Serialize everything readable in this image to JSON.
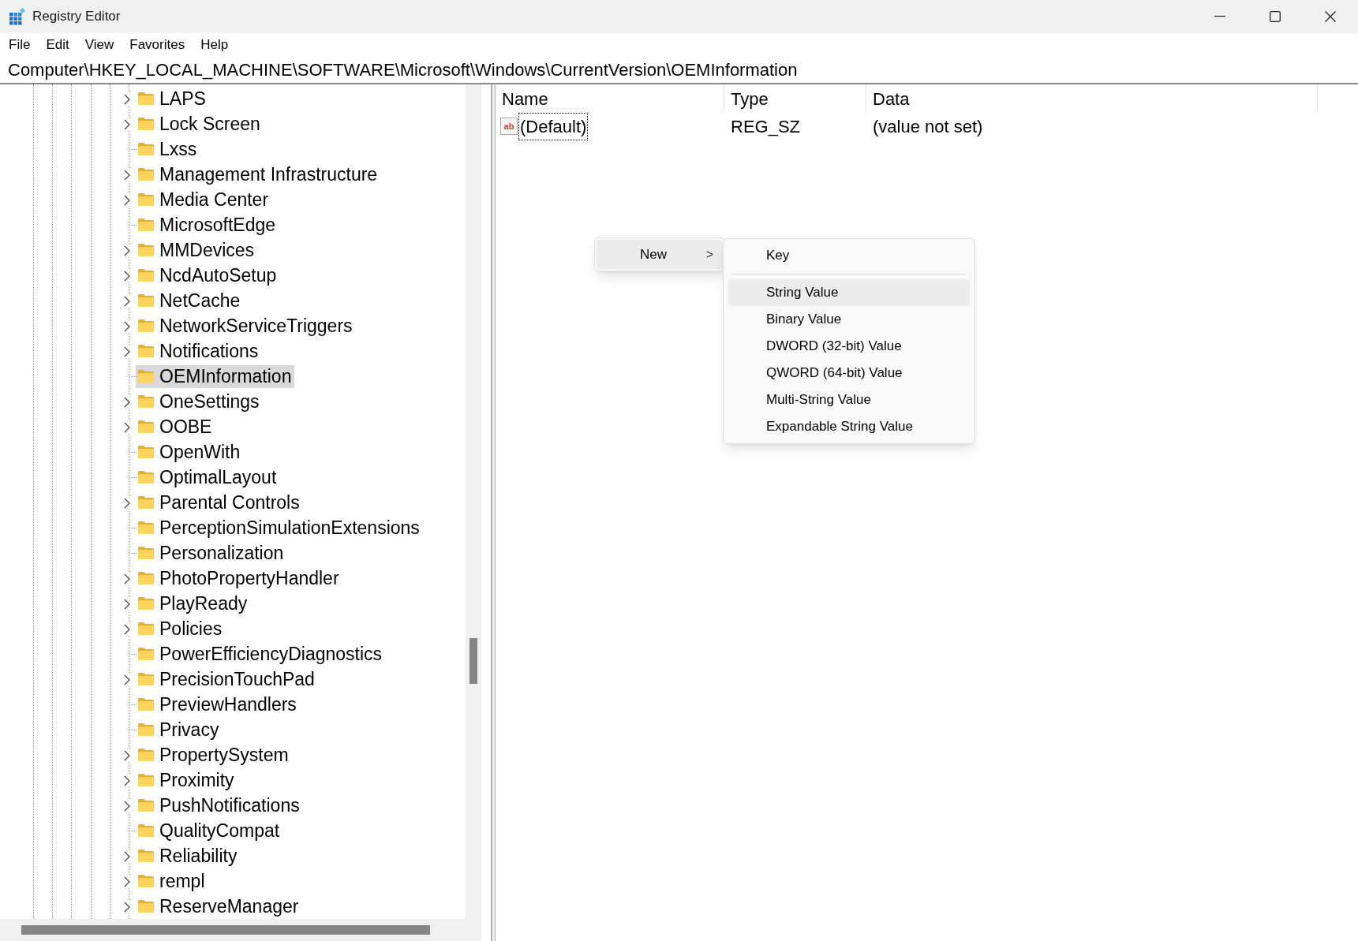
{
  "window": {
    "title": "Registry Editor"
  },
  "menu_bar": [
    "File",
    "Edit",
    "View",
    "Favorites",
    "Help"
  ],
  "address_bar": "Computer\\HKEY_LOCAL_MACHINE\\SOFTWARE\\Microsoft\\Windows\\CurrentVersion\\OEMInformation",
  "tree": [
    {
      "label": "LAPS",
      "expandable": true,
      "selected": false
    },
    {
      "label": "Lock Screen",
      "expandable": true,
      "selected": false
    },
    {
      "label": "Lxss",
      "expandable": false,
      "selected": false
    },
    {
      "label": "Management Infrastructure",
      "expandable": true,
      "selected": false
    },
    {
      "label": "Media Center",
      "expandable": true,
      "selected": false
    },
    {
      "label": "MicrosoftEdge",
      "expandable": false,
      "selected": false
    },
    {
      "label": "MMDevices",
      "expandable": true,
      "selected": false
    },
    {
      "label": "NcdAutoSetup",
      "expandable": true,
      "selected": false
    },
    {
      "label": "NetCache",
      "expandable": true,
      "selected": false
    },
    {
      "label": "NetworkServiceTriggers",
      "expandable": true,
      "selected": false
    },
    {
      "label": "Notifications",
      "expandable": true,
      "selected": false
    },
    {
      "label": "OEMInformation",
      "expandable": false,
      "selected": true
    },
    {
      "label": "OneSettings",
      "expandable": true,
      "selected": false
    },
    {
      "label": "OOBE",
      "expandable": true,
      "selected": false
    },
    {
      "label": "OpenWith",
      "expandable": false,
      "selected": false
    },
    {
      "label": "OptimalLayout",
      "expandable": false,
      "selected": false
    },
    {
      "label": "Parental Controls",
      "expandable": true,
      "selected": false
    },
    {
      "label": "PerceptionSimulationExtensions",
      "expandable": false,
      "selected": false
    },
    {
      "label": "Personalization",
      "expandable": false,
      "selected": false
    },
    {
      "label": "PhotoPropertyHandler",
      "expandable": true,
      "selected": false
    },
    {
      "label": "PlayReady",
      "expandable": true,
      "selected": false
    },
    {
      "label": "Policies",
      "expandable": true,
      "selected": false
    },
    {
      "label": "PowerEfficiencyDiagnostics",
      "expandable": false,
      "selected": false
    },
    {
      "label": "PrecisionTouchPad",
      "expandable": true,
      "selected": false
    },
    {
      "label": "PreviewHandlers",
      "expandable": false,
      "selected": false
    },
    {
      "label": "Privacy",
      "expandable": false,
      "selected": false
    },
    {
      "label": "PropertySystem",
      "expandable": true,
      "selected": false
    },
    {
      "label": "Proximity",
      "expandable": true,
      "selected": false
    },
    {
      "label": "PushNotifications",
      "expandable": true,
      "selected": false
    },
    {
      "label": "QualityCompat",
      "expandable": false,
      "selected": false
    },
    {
      "label": "Reliability",
      "expandable": true,
      "selected": false
    },
    {
      "label": "rempl",
      "expandable": true,
      "selected": false
    },
    {
      "label": "ReserveManager",
      "expandable": true,
      "selected": false
    }
  ],
  "values_table": {
    "columns": [
      "Name",
      "Type",
      "Data"
    ],
    "rows": [
      {
        "icon_text": "ab",
        "name": "(Default)",
        "type": "REG_SZ",
        "data": "(value not set)",
        "selected": true
      }
    ]
  },
  "context_menu": {
    "items": [
      {
        "label": "New",
        "expanded": true,
        "chevron": ">"
      }
    ],
    "submenu": [
      {
        "label": "Key",
        "selected": false,
        "separator_after": true
      },
      {
        "label": "String Value",
        "selected": true,
        "separator_after": false
      },
      {
        "label": "Binary Value",
        "selected": false,
        "separator_after": false
      },
      {
        "label": "DWORD (32-bit) Value",
        "selected": false,
        "separator_after": false
      },
      {
        "label": "QWORD (64-bit) Value",
        "selected": false,
        "separator_after": false
      },
      {
        "label": "Multi-String Value",
        "selected": false,
        "separator_after": false
      },
      {
        "label": "Expandable String Value",
        "selected": false,
        "separator_after": false
      }
    ]
  }
}
